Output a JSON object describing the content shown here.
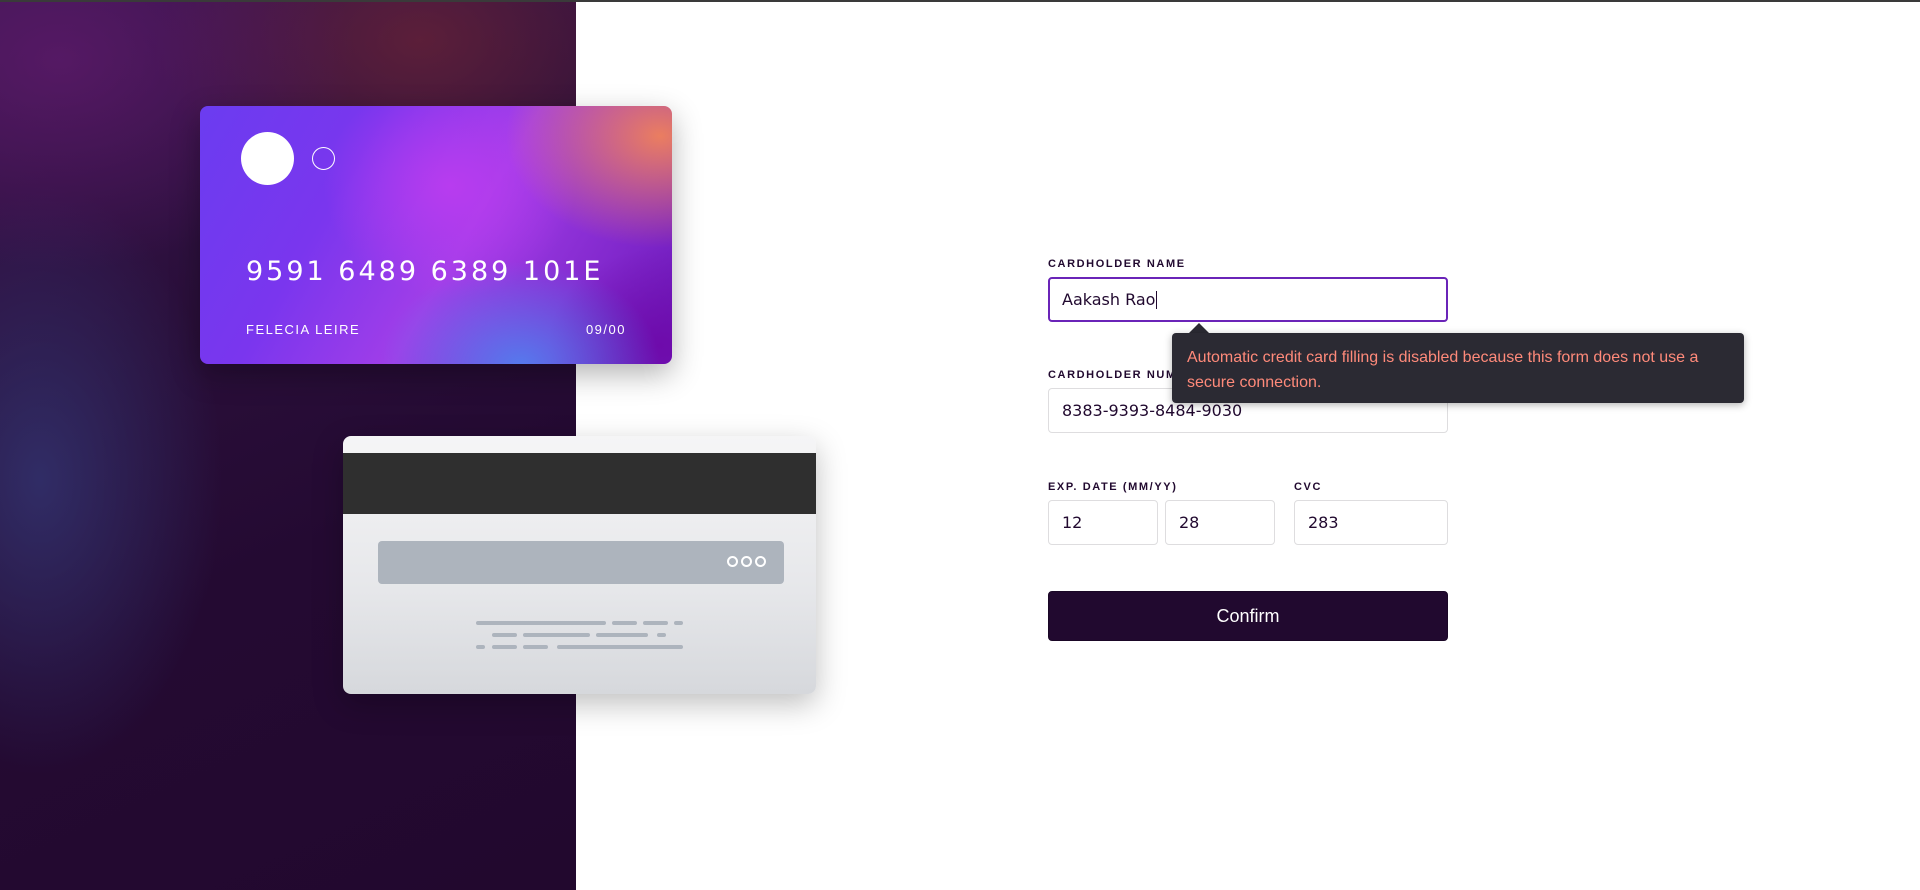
{
  "card_front": {
    "number": "9591 6489 6389 101E",
    "name": "FELECIA LEIRE",
    "expiry": "09/00"
  },
  "form": {
    "cardholder_name_label": "CARDHOLDER NAME",
    "cardholder_name_value": "Aakash Rao",
    "cardholder_number_label": "CARDHOLDER NUM",
    "cardholder_number_value": "8383-9393-8484-9030",
    "exp_date_label": "EXP. DATE (MM/YY)",
    "exp_month_value": "12",
    "exp_year_value": "28",
    "cvc_label": "CVC",
    "cvc_value": "283",
    "confirm_label": "Confirm"
  },
  "tooltip": {
    "message": "Automatic credit card filling is disabled because this form does not use a secure connection."
  },
  "colors": {
    "brand_dark": "#21092f",
    "focus_border": "#6a24b8",
    "warning_text": "#ff8a7a"
  }
}
